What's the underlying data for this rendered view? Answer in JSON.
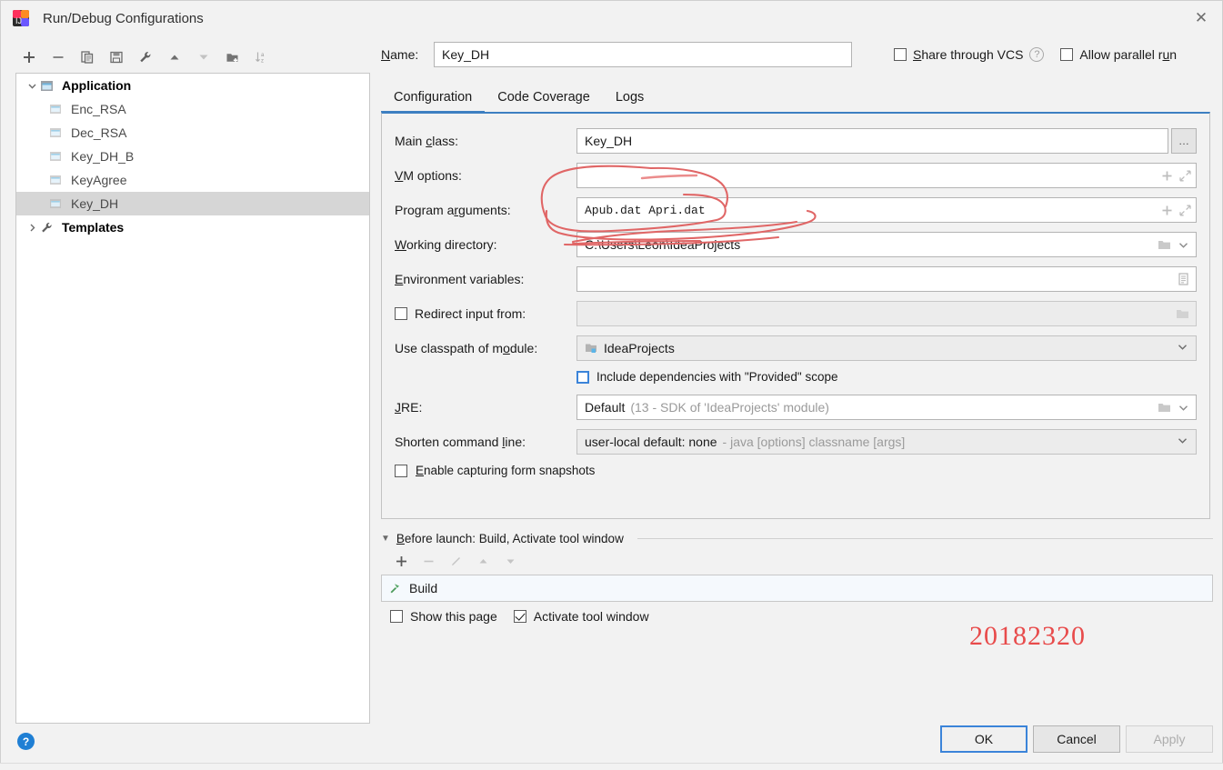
{
  "window": {
    "title": "Run/Debug Configurations",
    "close_label": "✕",
    "logo_icon": "intellij-idea-logo"
  },
  "tree_toolbar": {
    "buttons": [
      {
        "name": "add-configuration-button",
        "icon": "plus-icon",
        "label": "+"
      },
      {
        "name": "remove-configuration-button",
        "icon": "minus-icon",
        "label": "−"
      },
      {
        "name": "copy-configuration-button",
        "icon": "copy-icon",
        "label": "Copy"
      },
      {
        "name": "save-configuration-button",
        "icon": "save-icon",
        "label": "Save"
      },
      {
        "name": "edit-templates-button",
        "icon": "wrench-icon",
        "label": "Edit defaults"
      },
      {
        "name": "move-up-button",
        "icon": "arrow-up-icon",
        "label": "Move Up"
      },
      {
        "name": "move-down-button",
        "icon": "arrow-down-icon",
        "label": "Move Down"
      },
      {
        "name": "create-folder-button",
        "icon": "folder-add-icon",
        "label": "New Folder"
      },
      {
        "name": "sort-configurations-button",
        "icon": "sort-alpha-icon",
        "label": "Sort"
      }
    ]
  },
  "tree": {
    "group_label": "Application",
    "group_icon": "application-icon",
    "expand_arrow": "⌄",
    "collapse_arrow": "›",
    "items": [
      {
        "label": "Enc_RSA",
        "icon": "run-config-icon",
        "selected": false
      },
      {
        "label": "Dec_RSA",
        "icon": "run-config-icon",
        "selected": false
      },
      {
        "label": "Key_DH_B",
        "icon": "run-config-icon",
        "selected": false
      },
      {
        "label": "KeyAgree",
        "icon": "run-config-icon",
        "selected": false
      },
      {
        "label": "Key_DH",
        "icon": "run-config-icon",
        "selected": true
      }
    ],
    "templates_label": "Templates",
    "templates_icon": "wrench-icon"
  },
  "header": {
    "name_label": "Name:",
    "name_mnemonic": "N",
    "name_value": "Key_DH",
    "name_placeholder": "Name",
    "share_vcs_label": "Share through VCS",
    "share_vcs_mnemonic": "S",
    "share_vcs_checked": false,
    "help_icon": "help-circle-icon",
    "allow_parallel_label": "Allow parallel run",
    "allow_parallel_mnemonic": "u",
    "allow_parallel_checked": false
  },
  "tabs": [
    {
      "label": "Configuration",
      "active": true
    },
    {
      "label": "Code Coverage",
      "active": false
    },
    {
      "label": "Logs",
      "active": false
    }
  ],
  "form": {
    "main_class": {
      "label": "Main class:",
      "label_pre": "Main ",
      "label_mn": "c",
      "label_post": "lass:",
      "value": "Key_DH",
      "browse_label": "…",
      "browse_icon": "ellipsis-icon"
    },
    "vm_options": {
      "label_pre": "",
      "label_mn": "V",
      "label_post": "M options:",
      "value": "",
      "placeholder": "",
      "macro_icon": "plus-icon",
      "expand_icon": "expand-diagonal-icon"
    },
    "program_arguments": {
      "label_pre": "Program a",
      "label_mn": "r",
      "label_post": "guments:",
      "value": "Apub.dat  Apri.dat",
      "macro_icon": "plus-icon",
      "expand_icon": "expand-diagonal-icon"
    },
    "working_directory": {
      "label_pre": "",
      "label_mn": "W",
      "label_post": "orking directory:",
      "value": "C:\\Users\\Leon\\IdeaProjects",
      "browse_icon": "folder-icon",
      "chevron_icon": "chevron-down-icon"
    },
    "environment_variables": {
      "label_pre": "",
      "label_mn": "E",
      "label_post": "nvironment variables:",
      "value": "",
      "editor_icon": "list-edit-icon"
    },
    "redirect_input": {
      "label": "Redirect input from:",
      "label_pre": "Redirect input from:",
      "checked": false,
      "value": "",
      "disabled": true,
      "browse_icon": "folder-icon"
    },
    "classpath_module": {
      "label_pre": "Use classpath of m",
      "label_mn": "o",
      "label_post": "dule:",
      "value": "IdeaProjects",
      "module_icon": "module-icon",
      "chevron_icon": "chevron-down-icon"
    },
    "include_dependencies": {
      "label": "Include dependencies with \"Provided\" scope",
      "checked": false,
      "focused": true
    },
    "jre": {
      "label_pre": "",
      "label_mn": "J",
      "label_post": "RE:",
      "value": "Default",
      "value_hint": "(13 - SDK of 'IdeaProjects' module)",
      "browse_icon": "folder-icon",
      "chevron_icon": "chevron-down-icon"
    },
    "shorten_command_line": {
      "label_pre": "Shorten command ",
      "label_mn": "l",
      "label_post": "ine:",
      "value": "user-local default: none",
      "value_hint": "- java [options] classname [args]",
      "chevron_icon": "chevron-down-icon"
    },
    "enable_form_snapshots": {
      "label_pre": "",
      "label_mn": "E",
      "label_post": "nable capturing form snapshots",
      "checked": false
    }
  },
  "before_launch": {
    "expand_arrow": "▼",
    "title_pre": "",
    "title_mn": "B",
    "title_post": "efore launch: Build, Activate tool window",
    "toolbar": [
      {
        "name": "add-task-button",
        "icon": "plus-icon",
        "enabled": true
      },
      {
        "name": "remove-task-button",
        "icon": "minus-icon",
        "enabled": false
      },
      {
        "name": "edit-task-button",
        "icon": "pencil-icon",
        "enabled": false
      },
      {
        "name": "move-task-up-button",
        "icon": "arrow-up-icon",
        "enabled": false
      },
      {
        "name": "move-task-down-button",
        "icon": "arrow-down-icon",
        "enabled": false
      }
    ],
    "tasks": [
      {
        "label": "Build",
        "icon": "hammer-icon"
      }
    ],
    "show_this_page_label": "Show this page",
    "show_this_page_checked": false,
    "activate_tool_window_label": "Activate tool window",
    "activate_tool_window_checked": true
  },
  "footer": {
    "help_label": "?",
    "ok_label": "OK",
    "cancel_label": "Cancel",
    "apply_label": "Apply",
    "apply_enabled": false
  },
  "annotations": {
    "watermark_text": "20182320",
    "ink_color": "#e06666",
    "watermark_color": "#e84b4b",
    "circle_target": "program-arguments-field"
  },
  "colors": {
    "accent_blue": "#3d7fc1",
    "focus_blue": "#3b84d9",
    "dialog_bg": "#f2f2f2",
    "field_bg": "#ffffff",
    "disabled_bg": "#ececec",
    "selection_gray": "#d6d6d6",
    "hint_gray": "#9a9a9a"
  }
}
